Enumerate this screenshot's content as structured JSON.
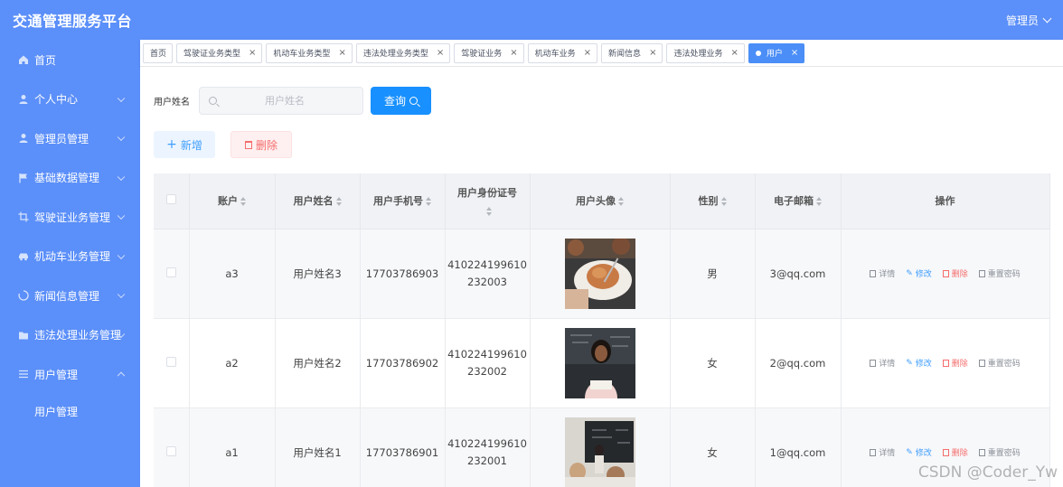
{
  "header": {
    "title": "交通管理服务平台",
    "user_label": "管理员"
  },
  "sidebar": {
    "items": [
      {
        "label": "首页",
        "icon": "home-icon"
      },
      {
        "label": "个人中心",
        "icon": "user-icon"
      },
      {
        "label": "管理员管理",
        "icon": "user-icon"
      },
      {
        "label": "基础数据管理",
        "icon": "flag-icon"
      },
      {
        "label": "驾驶证业务管理",
        "icon": "crop-icon"
      },
      {
        "label": "机动车业务管理",
        "icon": "car-icon"
      },
      {
        "label": "新闻信息管理",
        "icon": "loading-icon"
      },
      {
        "label": "违法处理业务管理",
        "icon": "folder-icon"
      },
      {
        "label": "用户管理",
        "icon": "list-icon"
      }
    ],
    "sub_item": "用户管理"
  },
  "tags": [
    {
      "label": "首页"
    },
    {
      "label": "驾驶证业务类型"
    },
    {
      "label": "机动车业务类型"
    },
    {
      "label": "违法处理业务类型"
    },
    {
      "label": "驾驶证业务"
    },
    {
      "label": "机动车业务"
    },
    {
      "label": "新闻信息"
    },
    {
      "label": "违法处理业务"
    },
    {
      "label": "用户",
      "active": true
    }
  ],
  "search": {
    "label": "用户姓名",
    "placeholder": "用户姓名",
    "query_button": "查询"
  },
  "actions": {
    "add": "新增",
    "delete": "删除"
  },
  "table": {
    "columns": [
      "账户",
      "用户姓名",
      "用户手机号",
      "用户身份证号",
      "用户头像",
      "性别",
      "电子邮箱",
      "操作"
    ],
    "rows": [
      {
        "account": "a3",
        "name": "用户姓名3",
        "phone": "17703786903",
        "id_line1": "410224199610",
        "id_line2": "232003",
        "gender": "男",
        "email": "3@qq.com"
      },
      {
        "account": "a2",
        "name": "用户姓名2",
        "phone": "17703786902",
        "id_line1": "410224199610",
        "id_line2": "232002",
        "gender": "女",
        "email": "2@qq.com"
      },
      {
        "account": "a1",
        "name": "用户姓名1",
        "phone": "17703786901",
        "id_line1": "410224199610",
        "id_line2": "232001",
        "gender": "女",
        "email": "1@qq.com"
      }
    ],
    "ops": {
      "detail": "详情",
      "edit": "修改",
      "delete": "删除",
      "reset": "重置密码"
    }
  },
  "watermark": "CSDN @Coder_Yw",
  "colors": {
    "primary": "#5b8ff9",
    "query": "#1890ff",
    "danger": "#f56c6c",
    "link": "#409eff"
  }
}
